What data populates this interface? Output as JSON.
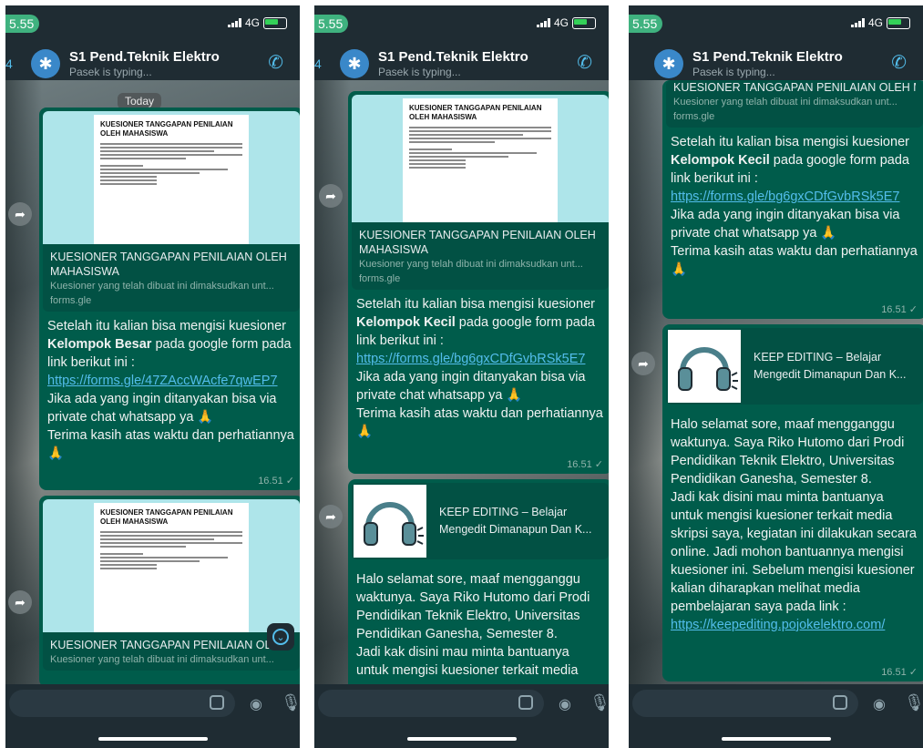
{
  "status": {
    "time": "5.55",
    "network": "4G"
  },
  "chat": {
    "back_count": "4",
    "title": "S1 Pend.Teknik Elektro",
    "subtitle": "Pasek is typing...",
    "date_chip": "Today"
  },
  "link_preview": {
    "doc_title": "KUESIONER TANGGAPAN PENILAIAN OLEH MAHASISWA",
    "title": "KUESIONER TANGGAPAN PENILAIAN OLEH MAHASISWA",
    "desc": "Kuesioner yang telah dibuat ini dimaksudkan unt...",
    "domain": "forms.gle"
  },
  "msg_besar": {
    "pre": "Setelah itu kalian bisa mengisi kuesioner ",
    "bold": "Kelompok Besar",
    "mid": " pada google form pada link berikut ini : ",
    "link": "https://forms.gle/47ZAccWAcfe7qwEP7",
    "post": "  Jika ada yang ingin ditanyakan bisa via private chat whatsapp ya 🙏",
    "thanks": "Terima kasih atas waktu dan perhatiannya 🙏",
    "time": "16.51 ✓"
  },
  "msg_kecil": {
    "pre": "Setelah itu kalian bisa mengisi kuesioner ",
    "bold": "Kelompok Kecil",
    "mid": " pada google form pada link berikut ini : ",
    "link": "https://forms.gle/bg6gxCDfGvbRSk5E7",
    "post": "  Jika ada yang ingin ditanyakan bisa via private chat whatsapp ya 🙏",
    "thanks": "Terima kasih atas waktu dan perhatiannya 🙏",
    "time": "16.51 ✓"
  },
  "keep": {
    "title": "KEEP EDITING – Belajar",
    "desc": "Mengedit Dimanapun Dan K...",
    "p1": "Halo selamat sore, maaf mengganggu waktunya. Saya Riko Hutomo dari Prodi Pendidikan Teknik Elektro, Universitas Pendidikan Ganesha, Semester 8.",
    "p2a": "Jadi kak disini mau minta bantuanya untuk mengisi kuesioner terkait media",
    "p2b": " skripsi saya, kegiatan ini dilakukan secara online. Jadi mohon bantuannya mengisi kuesioner ini. Sebelum mengisi kuesioner kalian diharapkan melihat media pembelajaran saya pada link : ",
    "link": "https://keepediting.pojokelektro.com/",
    "time": "16.51 ✓"
  },
  "icons": [
    "group-avatar-icon",
    "add-call-icon",
    "forward-icon",
    "scroll-down-icon",
    "sticker-icon",
    "camera-icon",
    "mic-icon"
  ]
}
